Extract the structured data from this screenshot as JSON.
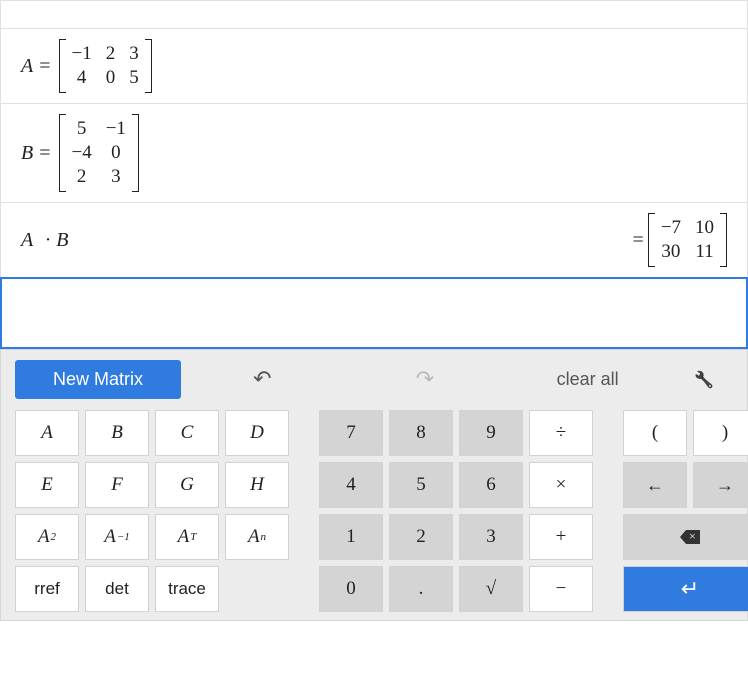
{
  "rows": {
    "a": {
      "var": "A",
      "eq": "=",
      "cols": 3,
      "cells": [
        "−1",
        "2",
        "3",
        "4",
        "0",
        "5"
      ]
    },
    "b": {
      "var": "B",
      "eq": "=",
      "cols": 2,
      "cells": [
        "5",
        "−1",
        "−4",
        "0",
        "2",
        "3"
      ]
    },
    "ab": {
      "lhs_a": "A",
      "dot": "·",
      "lhs_b": "B",
      "eq": "=",
      "cols": 2,
      "cells": [
        "−7",
        "10",
        "30",
        "11"
      ]
    }
  },
  "toolbar": {
    "new_matrix": "New Matrix",
    "clear_all": "clear all"
  },
  "keys": {
    "letters": [
      "A",
      "B",
      "C",
      "D",
      "E",
      "F",
      "G",
      "H"
    ],
    "funcs": {
      "a2_base": "A",
      "a2_sup": "2",
      "ainv_base": "A",
      "ainv_sup": "−1",
      "at_base": "A",
      "at_sup": "T",
      "an_base": "A",
      "an_sup": "n",
      "rref": "rref",
      "det": "det",
      "trace": "trace"
    },
    "num": [
      "7",
      "8",
      "9",
      "4",
      "5",
      "6",
      "1",
      "2",
      "3",
      "0",
      "."
    ],
    "sqrt": "√",
    "ops": {
      "div": "÷",
      "mul": "×",
      "add": "+",
      "sub": "−"
    },
    "paren": {
      "l": "(",
      "r": ")"
    }
  }
}
